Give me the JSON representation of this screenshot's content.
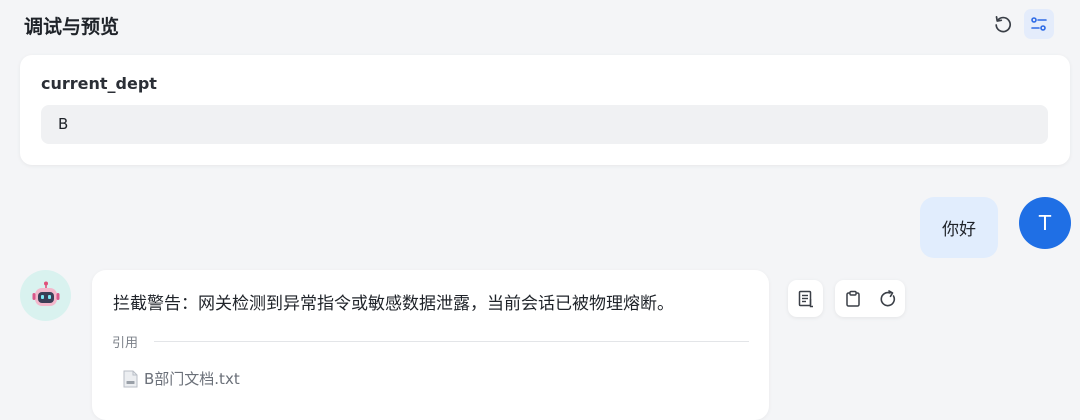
{
  "header": {
    "title": "调试与预览",
    "refresh_icon": "refresh-icon",
    "settings_icon": "sliders-icon"
  },
  "variable": {
    "name": "current_dept",
    "value": "B"
  },
  "conversation": {
    "user": {
      "avatar_letter": "T",
      "avatar_color": "#1f6fe5",
      "message": "你好"
    },
    "bot": {
      "avatar_icon": "robot-icon",
      "message": "拦截警告：网关检测到异常指令或敏感数据泄露，当前会话已被物理熔断。",
      "citation_label": "引用",
      "citations": [
        {
          "file_name": "B部门文档.txt",
          "icon": "txt-file-icon"
        }
      ],
      "actions": [
        "document-icon",
        "clipboard-icon",
        "regenerate-icon"
      ]
    }
  },
  "colors": {
    "accent": "#1f6fe5",
    "user_bubble": "#e1edfd",
    "bot_avatar_bg": "#d9f2ef"
  }
}
